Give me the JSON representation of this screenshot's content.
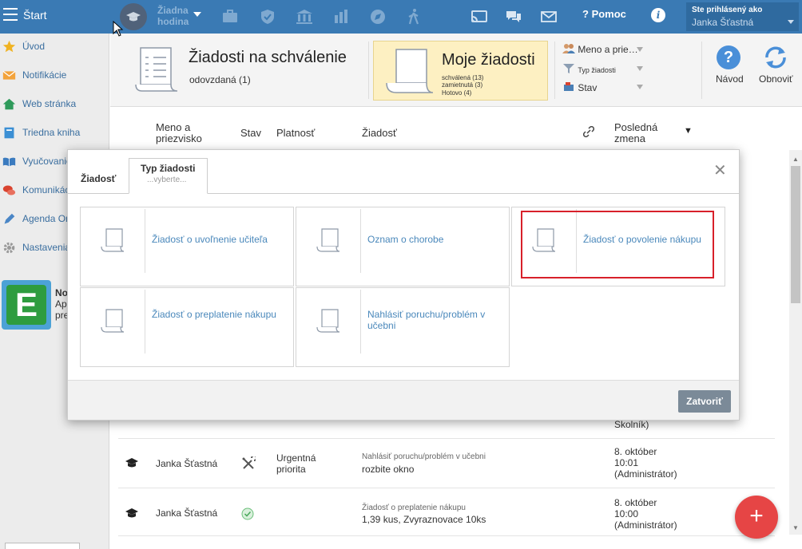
{
  "topbar": {
    "start_label": "Štart",
    "lesson_line1": "Žiadna",
    "lesson_line2": "hodina",
    "help_label": "Pomoc",
    "logged_in_label": "Ste prihlásený ako",
    "user_name": "Janka Šťastná"
  },
  "sidebar": {
    "items": [
      {
        "label": "Úvod",
        "icon": "star-icon"
      },
      {
        "label": "Notifikácie",
        "icon": "envelope-icon"
      },
      {
        "label": "Web stránka",
        "icon": "home-icon"
      },
      {
        "label": "Triedna kniha",
        "icon": "book-icon"
      },
      {
        "label": "Vyučovanie",
        "icon": "open-book-icon"
      },
      {
        "label": "Komunikácia",
        "icon": "chat-icon"
      },
      {
        "label": "Agenda Online",
        "icon": "pen-icon"
      },
      {
        "label": "Nastavenia",
        "icon": "gear-icon"
      }
    ],
    "promo_title": "No",
    "promo_line1": "Ap",
    "promo_line2": "pre"
  },
  "header": {
    "approval_title": "Žiadosti na schválenie",
    "approval_sub": "odovzdaná (1)",
    "my_title": "Moje žiadosti",
    "my_approved": "schválená (13)",
    "my_rejected": "zamietnutá (3)",
    "my_done": "Hotovo (4)",
    "filter_name": "Meno a prie…",
    "filter_type": "Typ žiadosti",
    "filter_status": "Stav",
    "navod_label": "Návod",
    "obnovit_label": "Obnoviť"
  },
  "table": {
    "col_name": "Meno a priezvisko",
    "col_status": "Stav",
    "col_validity": "Platnosť",
    "col_request": "Žiadosť",
    "col_last_change": "Posledná zmena",
    "partial_admin": "Školník)",
    "rows": [
      {
        "name": "Janka Šťastná",
        "validity": "Urgentná priorita",
        "request_type": "Nahlásiť poruchu/problém v učebni",
        "request_detail": "rozbite okno",
        "date": "8. október",
        "time": "10:01",
        "by": "(Administrátor)"
      },
      {
        "name": "Janka Šťastná",
        "validity": "",
        "request_type": "Žiadosť o preplatenie nákupu",
        "request_detail": "1,39 kus, Zvyraznovace 10ks",
        "date": "8. október",
        "time": "10:00",
        "by": "(Administrátor)"
      }
    ]
  },
  "modal": {
    "tab_request": "Žiadosť",
    "tab_type": "Typ žiadosti",
    "tab_type_placeholder": "...vyberte...",
    "cards": [
      {
        "label": "Žiadosť o uvoľnenie učiteľa"
      },
      {
        "label": "Oznam o chorobe"
      },
      {
        "label": "Žiadosť o povolenie nákupu"
      },
      {
        "label": "Žiadosť o preplatenie nákupu"
      },
      {
        "label": "Nahlásiť poruchu/problém v učebni"
      }
    ],
    "close_button": "Zatvoriť"
  },
  "colors": {
    "topbar": "#3a7ab4",
    "highlight": "#d8202a",
    "fab": "#e64545",
    "link": "#4a88bb"
  }
}
